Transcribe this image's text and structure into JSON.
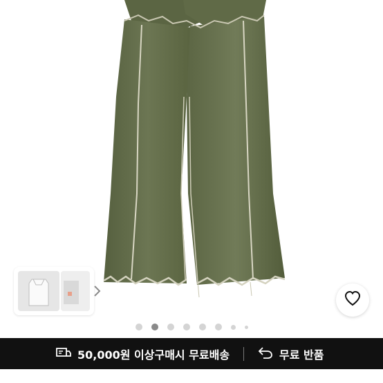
{
  "product": {
    "image_subject": "olive-green washed wide-leg jeans with frayed hems"
  },
  "thumbnails": {
    "next_icon": "chevron-right-icon"
  },
  "wishlist": {
    "icon": "heart-outline-icon"
  },
  "carousel": {
    "total_indicators": 8,
    "active_index": 1
  },
  "benefits": {
    "free_shipping_icon": "truck-icon",
    "free_shipping": "50,000원 이상구매시 무료배송",
    "free_return_icon": "return-arrow-icon",
    "free_return": "무료 반품"
  },
  "colors": {
    "denim": "#5f6a4a",
    "bar_bg": "#111111",
    "dot_active": "#8a8a8a",
    "dot_inactive": "#d4d4d4"
  }
}
